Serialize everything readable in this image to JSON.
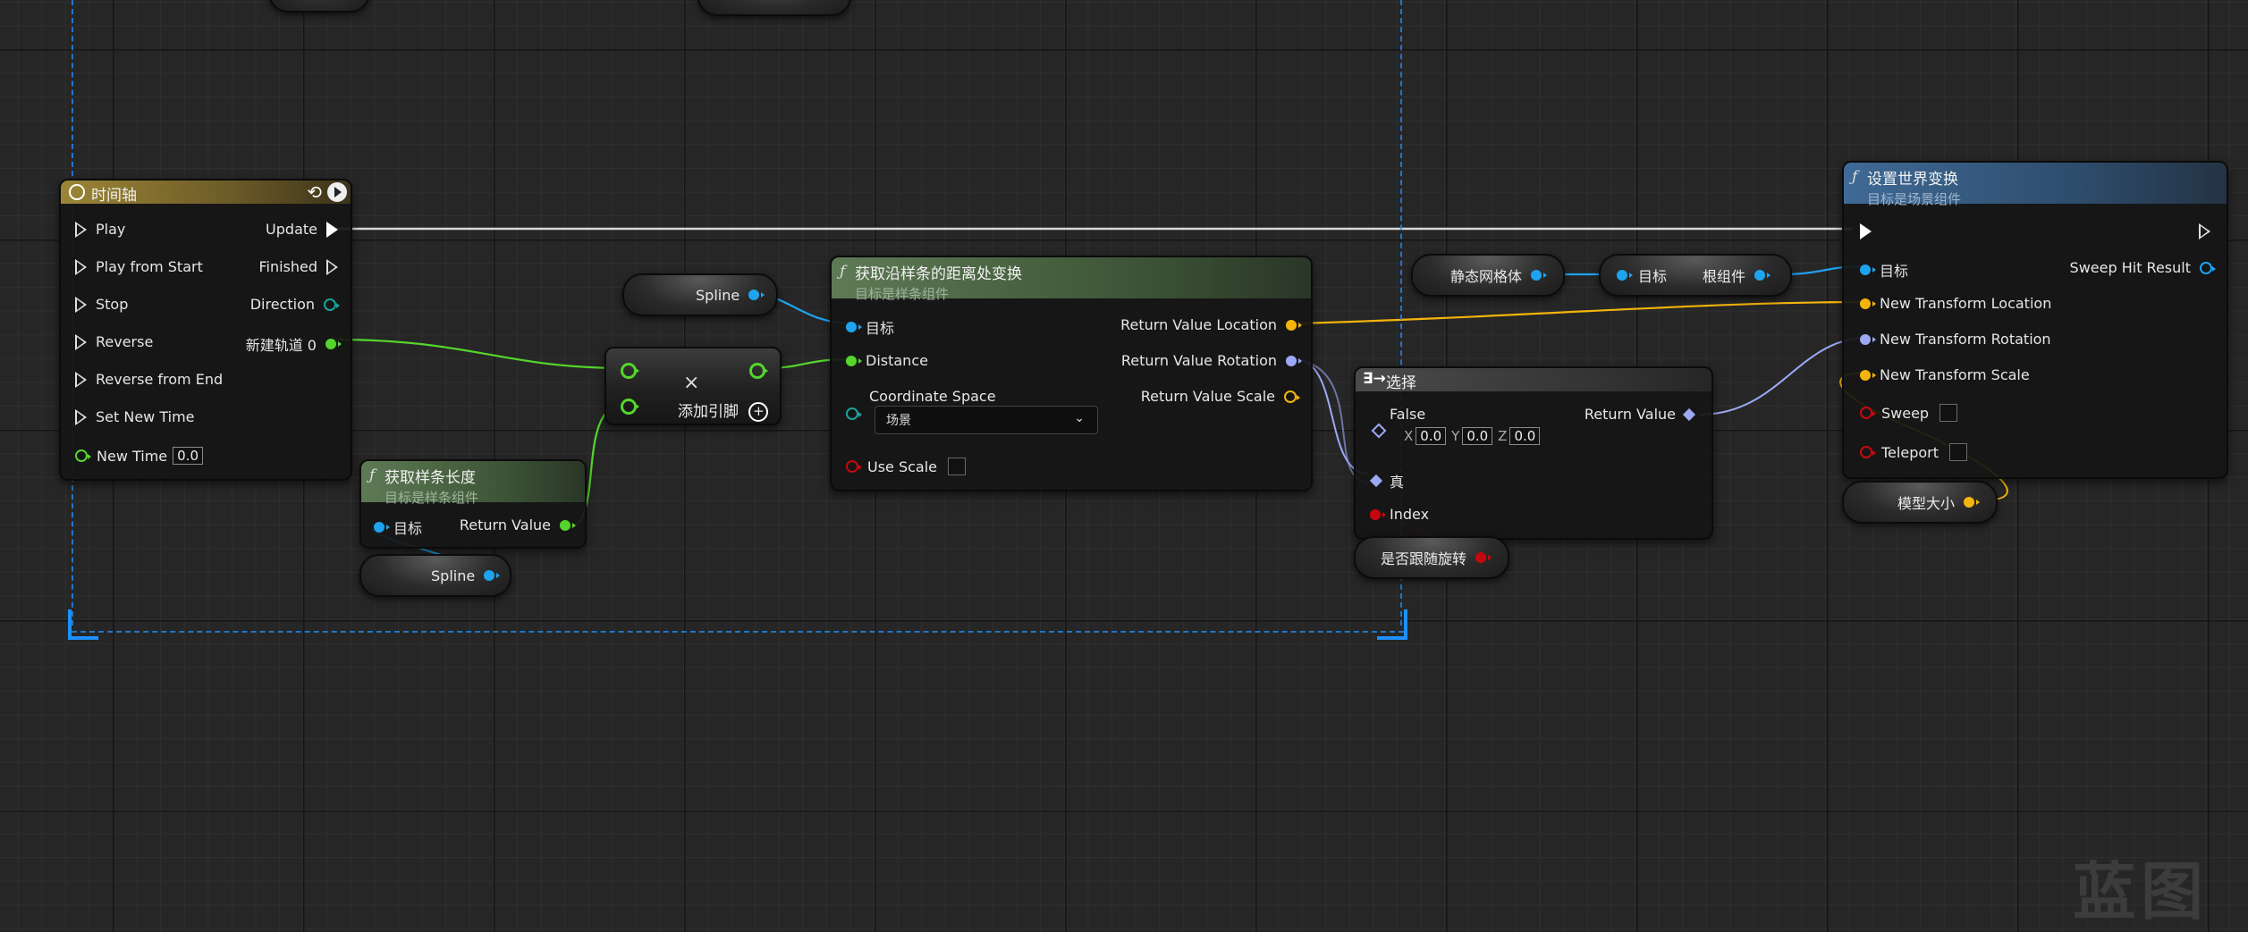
{
  "timeline_node": {
    "title": "时间轴",
    "inputs": [
      "Play",
      "Play from Start",
      "Stop",
      "Reverse",
      "Reverse from End",
      "Set New Time",
      "New Time"
    ],
    "new_time_value": "0.0",
    "outputs": [
      "Update",
      "Finished",
      "Direction",
      "新建轨道 0"
    ]
  },
  "get_spline_length": {
    "title": "获取样条长度",
    "subtitle": "目标是样条组件",
    "target": "目标",
    "return_value": "Return Value"
  },
  "spline_var_top": "Spline",
  "spline_var_bottom": "Spline",
  "add_node": {
    "label": "添加引脚",
    "symbol": "×",
    "plus": "+"
  },
  "get_transform_at_distance": {
    "title": "获取沿样条的距离处变换",
    "subtitle": "目标是样条组件",
    "inputs": [
      "目标",
      "Distance",
      "Coordinate Space",
      "Use Scale"
    ],
    "coordinate_space_value": "场景",
    "outputs": [
      "Return Value Location",
      "Return Value Rotation",
      "Return Value Scale"
    ]
  },
  "select_node": {
    "title": "选择",
    "false_label": "False",
    "vector": {
      "x_label": "X",
      "x": "0.0",
      "y_label": "Y",
      "y": "0.0",
      "z_label": "Z",
      "z": "0.0"
    },
    "true_label": "真",
    "index_label": "Index",
    "return_value": "Return Value"
  },
  "follow_rotation_var": "是否跟随旋转",
  "static_mesh_var": "静态网格体",
  "root_component_node": {
    "target": "目标",
    "output": "根组件"
  },
  "set_world_transform": {
    "title": "设置世界变换",
    "subtitle": "目标是场景组件",
    "inputs": [
      "目标",
      "New Transform Location",
      "New Transform Rotation",
      "New Transform Scale",
      "Sweep",
      "Teleport"
    ],
    "outputs": [
      "Sweep Hit Result"
    ]
  },
  "model_size_var": "模型大小",
  "watermark": "蓝图",
  "colors": {
    "exec": "#ffffff",
    "object": "#1ea3ef",
    "float": "#54d62c",
    "vector": "#f4b40c",
    "rotator": "#9da9f5",
    "bool": "#c6080e",
    "comment_border": "#1e90ff"
  }
}
